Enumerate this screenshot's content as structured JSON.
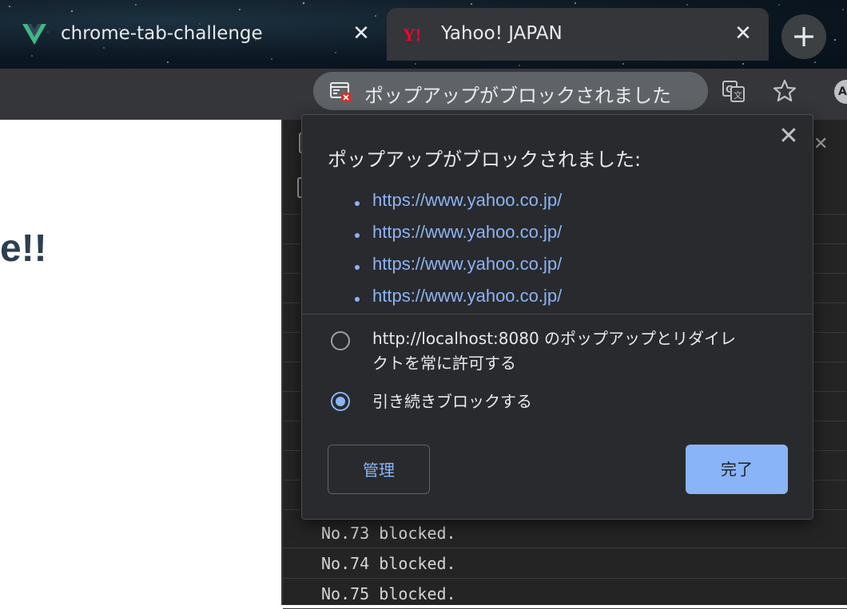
{
  "tabs": [
    {
      "title": "chrome-tab-challenge",
      "icon": "vue-logo-icon",
      "active": false
    },
    {
      "title": "Yahoo! JAPAN",
      "icon": "yahoo-logo-icon",
      "active": true
    }
  ],
  "new_tab_label": "+",
  "toolbar": {
    "popup_chip_label": "ポップアップがブロックされました",
    "avatar_text": "A"
  },
  "page": {
    "heading_fragment": "e!!"
  },
  "console": {
    "rows": [
      "No.73 blocked.",
      "No.74 blocked.",
      "No.75 blocked."
    ]
  },
  "popup": {
    "title": "ポップアップがブロックされました:",
    "urls": [
      "https://www.yahoo.co.jp/",
      "https://www.yahoo.co.jp/",
      "https://www.yahoo.co.jp/",
      "https://www.yahoo.co.jp/"
    ],
    "options": [
      {
        "label_line1": "http://localhost:8080 のポップアップとリダイレ",
        "label_line2": "クトを常に許可する",
        "selected": false
      },
      {
        "label_line1": "引き続きブロックする",
        "selected": true
      }
    ],
    "manage_label": "管理",
    "done_label": "完了"
  },
  "colors": {
    "accent": "#8ab4f8",
    "popup_bg": "#292a2d",
    "toolbar_bg": "#35363a"
  }
}
